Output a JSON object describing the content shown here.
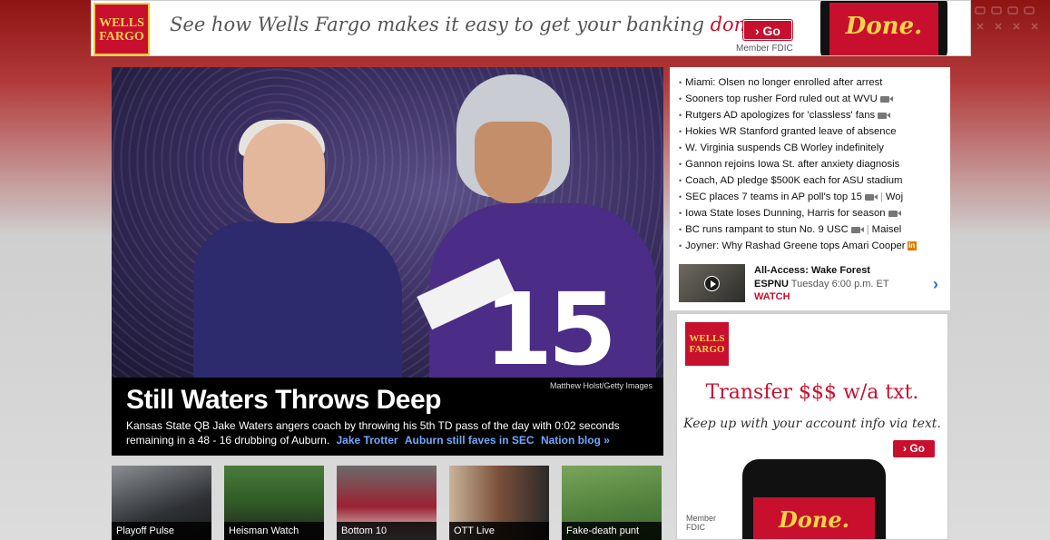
{
  "banner": {
    "logo_line1": "WELLS",
    "logo_line2": "FARGO",
    "text_before": "See how Wells Fargo makes it easy to get your banking ",
    "text_highlight": "done.",
    "go_label": "Go",
    "member_fdic": "Member FDIC",
    "phone_text": "Done."
  },
  "hero": {
    "photo_credit": "Matthew Holst/Getty Images",
    "title": "Still Waters Throws Deep",
    "description": "Kansas State QB Jake Waters angers coach by throwing his 5th TD pass of the day with 0:02 seconds remaining in a 48 - 16 drubbing of Auburn.",
    "links": [
      "Jake Trotter",
      "Auburn still faves in SEC",
      "Nation blog »"
    ],
    "jersey_number": "15"
  },
  "thumbnails": [
    {
      "label": "Playoff Pulse"
    },
    {
      "label": "Heisman Watch"
    },
    {
      "label": "Bottom 10"
    },
    {
      "label": "OTT Live"
    },
    {
      "label": "Fake-death punt"
    }
  ],
  "headlines": [
    {
      "text": "Miami: Olsen no longer enrolled after arrest",
      "icon": "",
      "extra": ""
    },
    {
      "text": "Sooners top rusher Ford ruled out at WVU",
      "icon": "video-icon",
      "extra": ""
    },
    {
      "text": "Rutgers AD apologizes for 'classless' fans",
      "icon": "video-icon",
      "extra": ""
    },
    {
      "text": "Hokies WR Stanford granted leave of absence",
      "icon": "",
      "extra": ""
    },
    {
      "text": "W. Virginia suspends CB Worley indefinitely",
      "icon": "",
      "extra": ""
    },
    {
      "text": "Gannon rejoins Iowa St. after anxiety diagnosis",
      "icon": "",
      "extra": ""
    },
    {
      "text": "Coach, AD pledge $500K each for ASU stadium",
      "icon": "",
      "extra": ""
    },
    {
      "text": "SEC places 7 teams in AP poll's top 15",
      "icon": "video-icon",
      "extra": "Woj"
    },
    {
      "text": "Iowa State loses Dunning, Harris for season",
      "icon": "video-icon",
      "extra": ""
    },
    {
      "text": "BC runs rampant to stun No. 9 USC",
      "icon": "video-icon",
      "extra": "Maisel"
    },
    {
      "text": "Joyner: Why Rashad Greene tops Amari Cooper",
      "icon": "insider-icon",
      "extra": ""
    }
  ],
  "all_access": {
    "title": "All-Access: Wake Forest",
    "network": "ESPNU",
    "time": "Tuesday 6:00 p.m.",
    "tz": "ET",
    "watch": "WATCH"
  },
  "side_ad": {
    "logo_line1": "WELLS",
    "logo_line2": "FARGO",
    "title": "Transfer $$$ w/a txt.",
    "subtitle": "Keep up with your account info via text.",
    "go_label": "Go",
    "phone_text": "Done.",
    "member_line1": "Member",
    "member_line2": "FDIC"
  },
  "colors": {
    "brand_red": "#c8102e",
    "gold": "#f5d34b",
    "link_blue": "#6fa8ff"
  }
}
